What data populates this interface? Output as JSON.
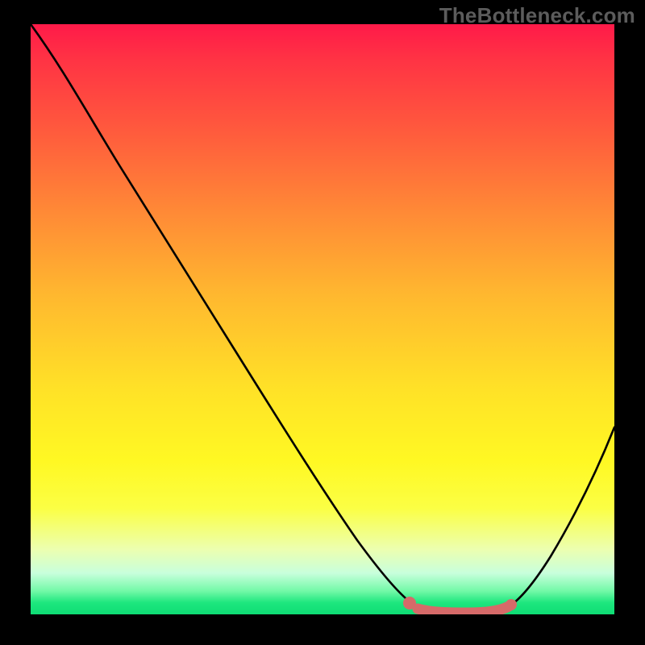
{
  "watermark": "TheBottleneck.com",
  "chart_data": {
    "type": "line",
    "title": "",
    "xlabel": "",
    "ylabel": "",
    "xlim": [
      0,
      100
    ],
    "ylim": [
      0,
      100
    ],
    "grid": false,
    "legend": false,
    "series": [
      {
        "name": "bottleneck-curve",
        "x": [
          0,
          5,
          10,
          15,
          20,
          25,
          30,
          35,
          40,
          45,
          50,
          55,
          60,
          63,
          66,
          70,
          74,
          78,
          82,
          86,
          90,
          95,
          100
        ],
        "y": [
          100,
          92,
          84,
          77,
          69,
          61,
          53,
          45,
          37,
          29,
          21,
          14,
          8,
          4,
          1.5,
          0.3,
          0.2,
          0.3,
          1.2,
          4,
          10,
          20,
          34
        ]
      }
    ],
    "highlight": {
      "name": "optimal-zone",
      "x_start": 63,
      "x_end": 83,
      "y_approx": 0.3
    },
    "background_gradient": {
      "stops": [
        {
          "pos": 0.0,
          "color": "#ff1a49"
        },
        {
          "pos": 0.18,
          "color": "#ff5a3d"
        },
        {
          "pos": 0.46,
          "color": "#ffb82f"
        },
        {
          "pos": 0.74,
          "color": "#fff823"
        },
        {
          "pos": 0.93,
          "color": "#c8ffdc"
        },
        {
          "pos": 1.0,
          "color": "#0edc74"
        }
      ]
    }
  }
}
